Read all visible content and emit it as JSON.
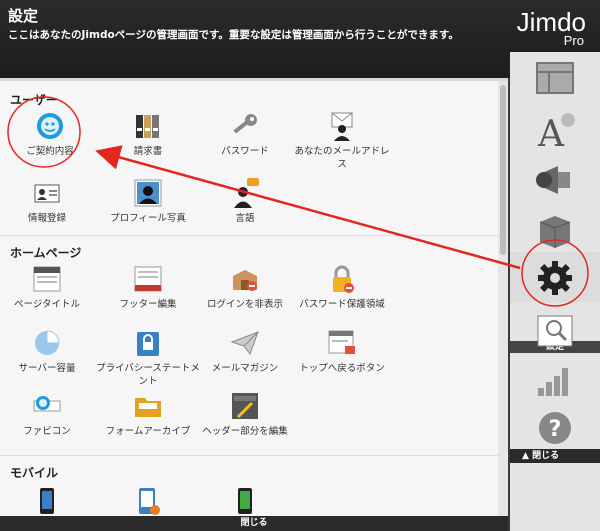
{
  "header": {
    "title": "設定",
    "description": "ここはあなたのJimdoページの管理画面です。重要な設定は管理画面から行うことができます。",
    "logo": "Jimdo",
    "logo_sub": "Pro"
  },
  "sections": [
    {
      "title": "ユーザー",
      "items": [
        {
          "label": "ご契約内容",
          "icon": "contract-smiley-icon"
        },
        {
          "label": "請求書",
          "icon": "invoice-binders-icon"
        },
        {
          "label": "パスワード",
          "icon": "key-icon"
        },
        {
          "label": "あなたのメールアドレス",
          "icon": "mail-user-icon"
        },
        {
          "label": "情報登録",
          "icon": "id-card-icon"
        },
        {
          "label": "プロフィール写真",
          "icon": "profile-photo-icon"
        },
        {
          "label": "言語",
          "icon": "language-speech-icon"
        }
      ]
    },
    {
      "title": "ホームページ",
      "items": [
        {
          "label": "ページタイトル",
          "icon": "page-title-icon"
        },
        {
          "label": "フッター編集",
          "icon": "footer-edit-icon"
        },
        {
          "label": "ログインを非表示",
          "icon": "login-hide-icon"
        },
        {
          "label": "パスワード保護領域",
          "icon": "password-protect-icon"
        },
        {
          "label": "サーバー容量",
          "icon": "pie-chart-icon"
        },
        {
          "label": "プライバシーステートメント",
          "icon": "privacy-lock-icon"
        },
        {
          "label": "メールマガジン",
          "icon": "paper-plane-icon"
        },
        {
          "label": "トップへ戻るボタン",
          "icon": "back-to-top-icon"
        },
        {
          "label": "ファビコン",
          "icon": "favicon-icon"
        },
        {
          "label": "フォームアーカイブ",
          "icon": "folder-icon"
        },
        {
          "label": "ヘッダー部分を編集",
          "icon": "head-tag-icon"
        }
      ]
    },
    {
      "title": "モバイル",
      "items": [
        {
          "label": "",
          "icon": "smartphone-icon"
        },
        {
          "label": "",
          "icon": "mobile-home-icon"
        },
        {
          "label": "",
          "icon": "mobile-code-icon"
        }
      ]
    }
  ],
  "bottom_bar": {
    "label": "閉じる"
  },
  "rail": {
    "items": [
      "layout-icon",
      "font-style-icon",
      "megaphone-icon",
      "package-icon",
      "settings-gear-icon",
      "seo-icon",
      "stats-bars-icon",
      "help-icon"
    ],
    "settings_label": "設定",
    "close_label": "閉じる"
  },
  "colors": {
    "header_bg": "#1f1f1f",
    "rail_bg": "#e4e4e4",
    "panel_bg": "#f6f6f6",
    "annotation_red": "#e5261f"
  }
}
